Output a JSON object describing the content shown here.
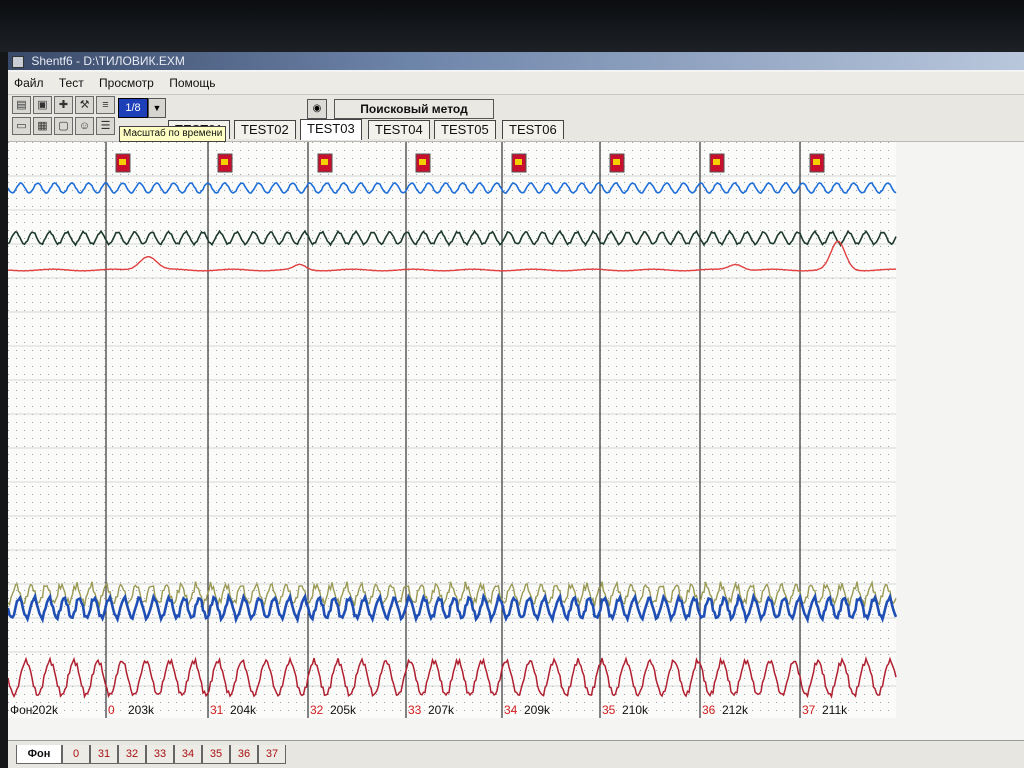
{
  "window": {
    "title": "Shentf6 - D:\\ТИЛОВИК.EXM"
  },
  "menu": [
    "Файл",
    "Тест",
    "Просмотр",
    "Помощь"
  ],
  "toolbar": {
    "scale_value": "1/8",
    "scale_tooltip": "Масштаб по времени",
    "method_label": "Поисковый метод",
    "buttons": [
      "open-folder-icon",
      "save-icon",
      "add-icon",
      "wrench-icon",
      "list-icon",
      "folder-icon",
      "table-icon",
      "comment-icon",
      "face-icon",
      "lines-icon"
    ]
  },
  "test_tabs": [
    "TEST01",
    "TEST02",
    "TEST03",
    "TEST04",
    "TEST05",
    "TEST06"
  ],
  "active_test_tab": "TEST03",
  "segments": [
    {
      "id": "Фон",
      "value": "202k"
    },
    {
      "id": "0",
      "value": "203k"
    },
    {
      "id": "31",
      "value": "204k"
    },
    {
      "id": "32",
      "value": "205k"
    },
    {
      "id": "33",
      "value": "207k"
    },
    {
      "id": "34",
      "value": "209k"
    },
    {
      "id": "35",
      "value": "210k"
    },
    {
      "id": "36",
      "value": "212k"
    },
    {
      "id": "37",
      "value": "211k"
    }
  ],
  "bottom_tabs": [
    "Фон",
    "0",
    "31",
    "32",
    "33",
    "34",
    "35",
    "36",
    "37"
  ],
  "colors": {
    "channel1": "#1f6fd8",
    "channel2": "#1d3a2c",
    "channel3": "#e04040",
    "channel4_main": "#1f4fb5",
    "channel4_alt": "#9a9a55",
    "channel5": "#b02030",
    "segment_id": "#d02020"
  }
}
